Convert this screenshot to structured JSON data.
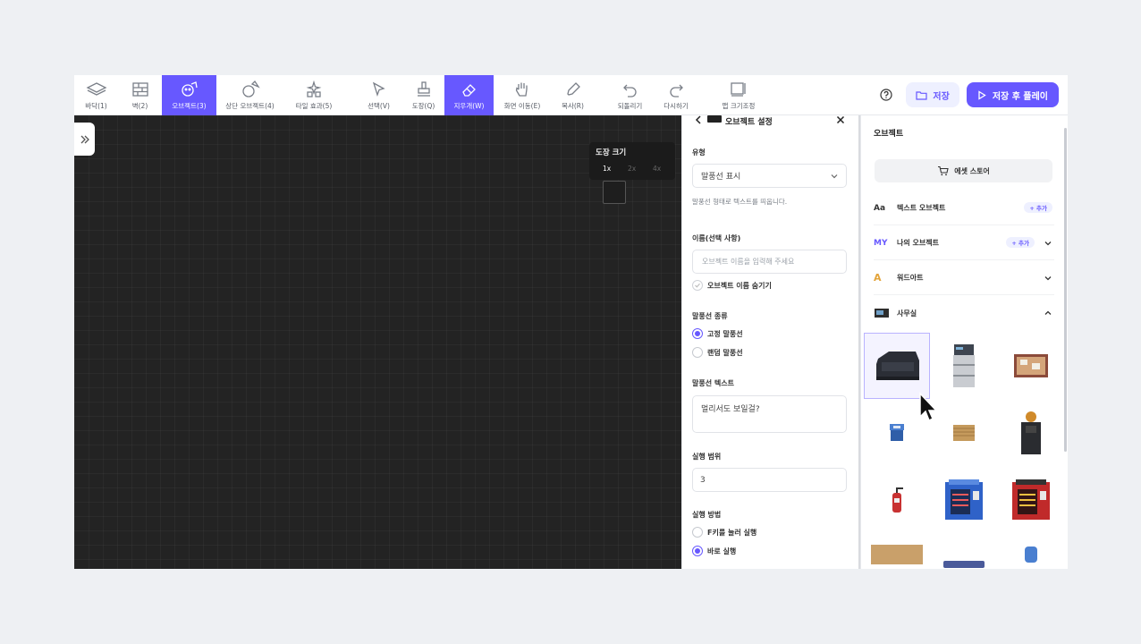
{
  "toolbar": {
    "tools": [
      {
        "id": "floor",
        "label": "바닥(1)"
      },
      {
        "id": "wall",
        "label": "벽(2)"
      },
      {
        "id": "object",
        "label": "오브젝트(3)"
      },
      {
        "id": "top-object",
        "label": "상단 오브젝트(4)"
      },
      {
        "id": "tile-effect",
        "label": "타일 효과(5)"
      },
      {
        "id": "select",
        "label": "선택(V)"
      },
      {
        "id": "stamp",
        "label": "도장(Q)"
      },
      {
        "id": "eraser",
        "label": "지우개(W)"
      },
      {
        "id": "pan",
        "label": "화면 이동(E)"
      },
      {
        "id": "copy",
        "label": "복사(R)"
      },
      {
        "id": "undo",
        "label": "되돌리기"
      },
      {
        "id": "redo",
        "label": "다시하기"
      },
      {
        "id": "resize",
        "label": "맵 크기조정"
      }
    ],
    "save_label": "저장",
    "save_play_label": "저장 후 플레이",
    "accent": "#6758ff"
  },
  "canvas": {
    "stamp_title": "도장 크기",
    "stamp_sizes": [
      "1x",
      "2x",
      "4x"
    ]
  },
  "settings": {
    "title": "오브젝트 설정",
    "type_label": "유형",
    "type_value": "말풍선 표시",
    "type_help": "말풍선 형태로 텍스트를 띄웁니다.",
    "name_label": "이름(선택 사항)",
    "name_placeholder": "오브젝트 이름을 입력해 주세요",
    "hide_name_label": "오브젝트 이름 숨기기",
    "bubble_kind_label": "말풍선 종류",
    "bubble_fixed": "고정 말풍선",
    "bubble_random": "랜덤 말풍선",
    "bubble_text_label": "말풍선 텍스트",
    "bubble_text_value": "멀리서도 보일걸?",
    "range_label": "실행 범위",
    "range_value": "3",
    "method_label": "실행 방법",
    "method_f": "F키를 눌러 실행",
    "method_instant": "바로 실행"
  },
  "objects": {
    "title": "오브젝트",
    "store_label": "에셋 스토어",
    "categories": [
      {
        "icon": "Aa",
        "label": "텍스트 오브젝트",
        "add": "+ 추가"
      },
      {
        "icon": "MY",
        "label": "나의 오브젝트",
        "add": "+ 추가"
      },
      {
        "icon": "A",
        "label": "워드아트"
      },
      {
        "icon": "office",
        "label": "사무실"
      }
    ]
  }
}
